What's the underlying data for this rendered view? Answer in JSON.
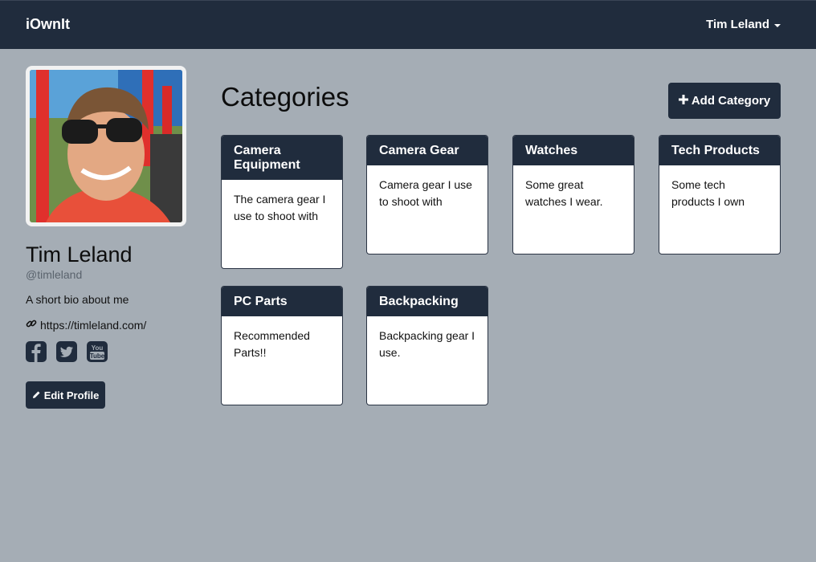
{
  "navbar": {
    "brand": "iOwnIt",
    "user_menu_label": "Tim Leland"
  },
  "profile": {
    "name": "Tim Leland",
    "handle": "@timleland",
    "bio": "A short bio about me",
    "website": "https://timleland.com/",
    "social_icons": [
      "facebook-icon",
      "twitter-icon",
      "youtube-icon"
    ],
    "edit_label": "Edit Profile"
  },
  "main": {
    "title": "Categories",
    "add_label": "Add Category"
  },
  "categories": [
    {
      "title": "Camera Equipment",
      "description": "The camera gear I use to shoot with"
    },
    {
      "title": "Camera Gear",
      "description": "Camera gear I use to shoot with"
    },
    {
      "title": "Watches",
      "description": "Some great watches I wear."
    },
    {
      "title": "Tech Products",
      "description": "Some tech products I own"
    },
    {
      "title": "PC Parts",
      "description": "Recommended Parts!!"
    },
    {
      "title": "Backpacking",
      "description": "Backpacking gear I use."
    }
  ],
  "colors": {
    "page_background": "#a5adb5",
    "navbar": "#202c3d",
    "card_header": "#202c3d",
    "button": "#202c3d"
  }
}
